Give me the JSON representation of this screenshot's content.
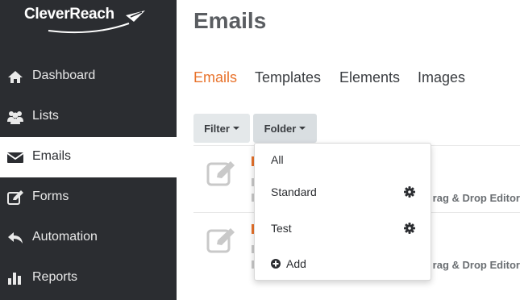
{
  "brand": {
    "logo_text": "CleverReach"
  },
  "sidebar": {
    "items": [
      {
        "label": "Dashboard",
        "icon": "home-icon",
        "active": false
      },
      {
        "label": "Lists",
        "icon": "users-icon",
        "active": false
      },
      {
        "label": "Emails",
        "icon": "envelope-icon",
        "active": true
      },
      {
        "label": "Forms",
        "icon": "edit-form-icon",
        "active": false
      },
      {
        "label": "Automation",
        "icon": "reply-icon",
        "active": false
      },
      {
        "label": "Reports",
        "icon": "bar-chart-icon",
        "active": false
      }
    ]
  },
  "main": {
    "title": "Emails",
    "tabs": [
      {
        "label": "Emails",
        "active": true
      },
      {
        "label": "Templates",
        "active": false
      },
      {
        "label": "Elements",
        "active": false
      },
      {
        "label": "Images",
        "active": false
      }
    ],
    "toolbar": {
      "filter_label": "Filter",
      "folder_label": "Folder"
    },
    "rows": [
      {
        "editor_text": "rag & Drop Editor"
      },
      {
        "editor_text": "rag & Drop Editor"
      }
    ]
  },
  "folder_dropdown": {
    "items": [
      {
        "label": "All",
        "icon": null
      },
      {
        "label": "Standard",
        "icon": "gear-icon"
      },
      {
        "label": "Test",
        "icon": "gear-icon"
      },
      {
        "label": "Add",
        "icon": "plus-circle-icon"
      }
    ]
  },
  "colors": {
    "sidebar_bg": "#2b2d31",
    "accent": "#e8722b",
    "button_bg": "#e4e8ea"
  }
}
